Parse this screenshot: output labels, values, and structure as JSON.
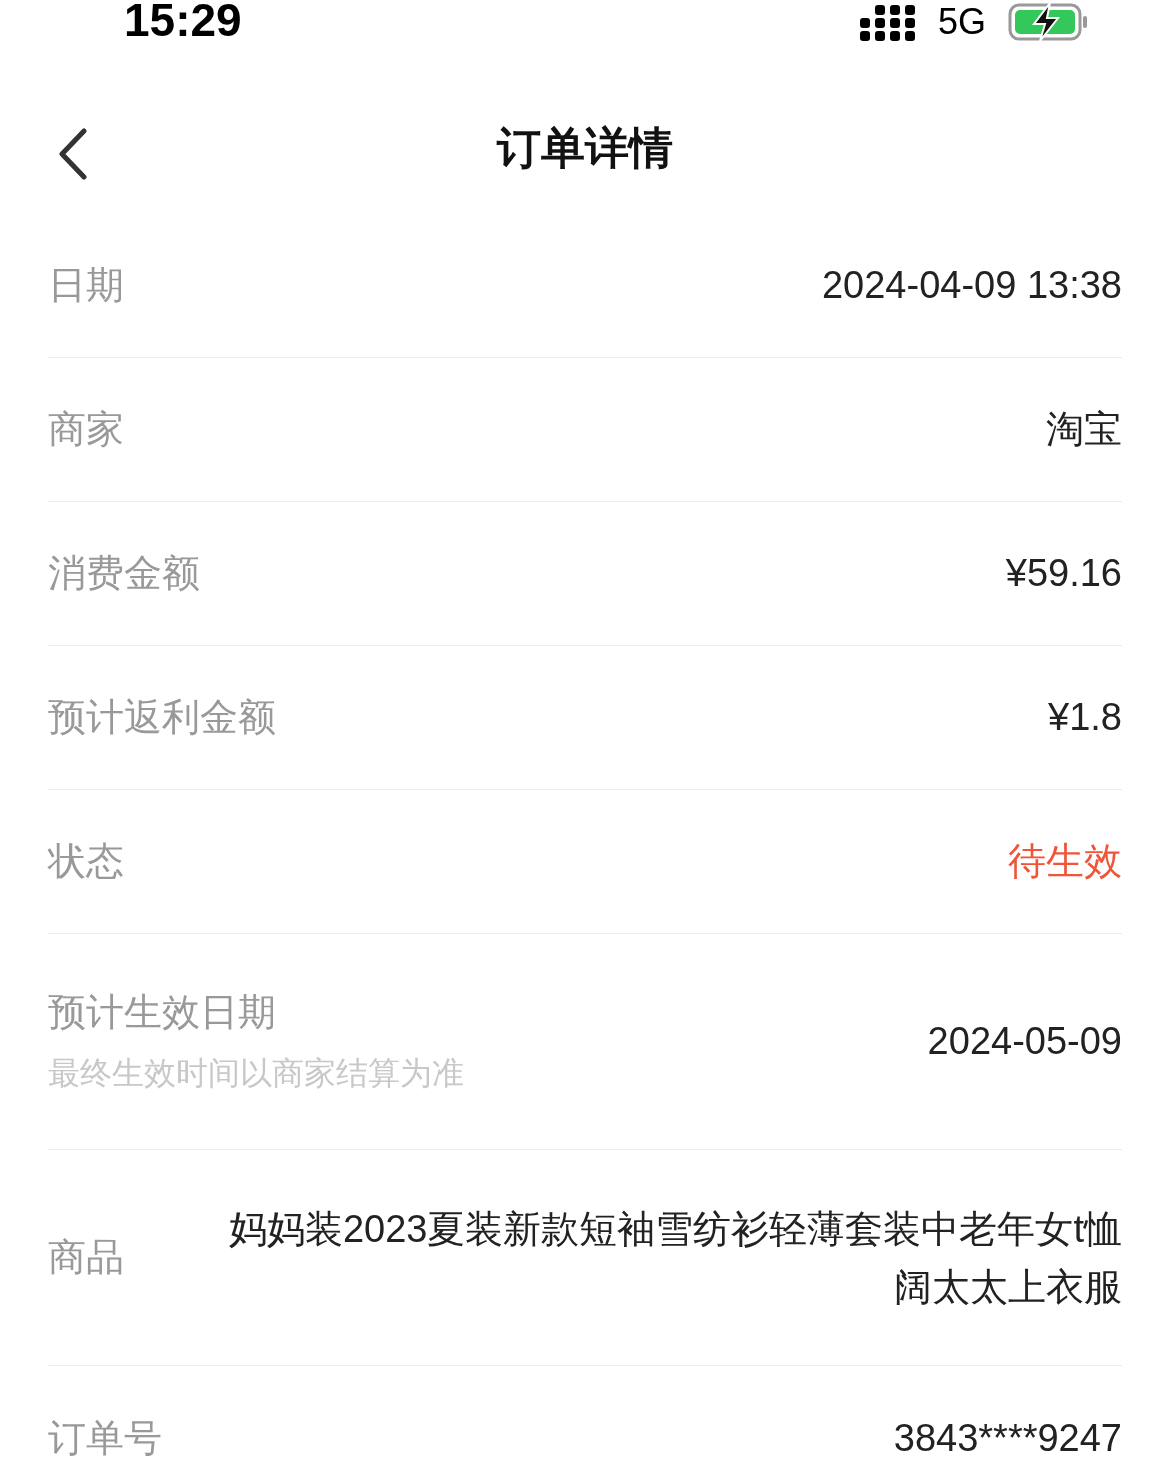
{
  "status_bar": {
    "time": "15:29",
    "network": "5G"
  },
  "nav": {
    "title": "订单详情"
  },
  "rows": [
    {
      "kind": "plain",
      "label": "日期",
      "value": "2024-04-09 13:38",
      "alert": false
    },
    {
      "kind": "plain",
      "label": "商家",
      "value": "淘宝",
      "alert": false
    },
    {
      "kind": "plain",
      "label": "消费金额",
      "value": "¥59.16",
      "alert": false
    },
    {
      "kind": "plain",
      "label": "预计返利金额",
      "value": "¥1.8",
      "alert": false
    },
    {
      "kind": "plain",
      "label": "状态",
      "value": "待生效",
      "alert": true
    },
    {
      "kind": "note",
      "label": "预计生效日期",
      "note": "最终生效时间以商家结算为准",
      "value": "2024-05-09",
      "alert": false
    },
    {
      "kind": "wrap",
      "label": "商品",
      "value": "妈妈装2023夏装新款短袖雪纺衫轻薄套装中老年女t恤阔太太上衣服",
      "alert": false
    },
    {
      "kind": "plain",
      "label": "订单号",
      "value": "3843****9247",
      "alert": false
    }
  ]
}
